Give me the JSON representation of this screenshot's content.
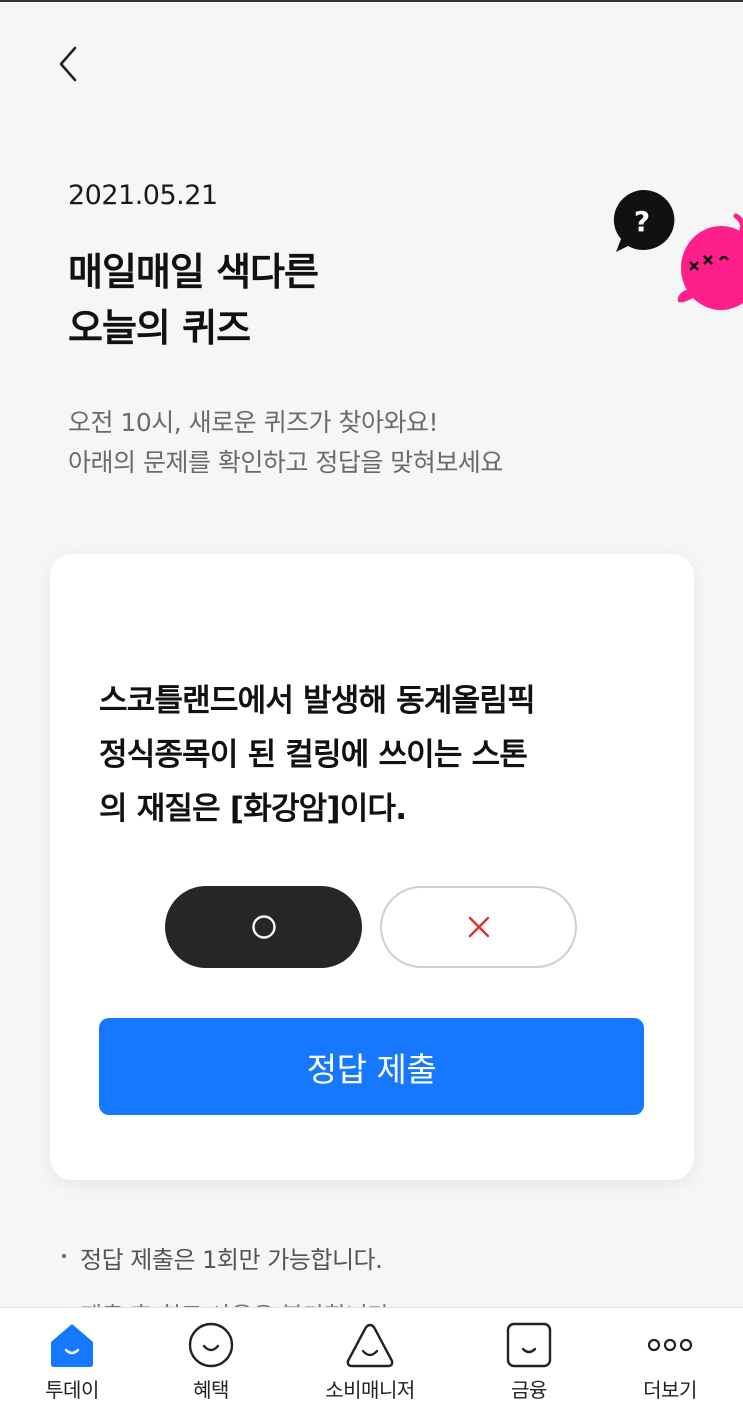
{
  "header": {
    "date": "2021.05.21",
    "title_lines": [
      "매일매일 색다른",
      "오늘의 퀴즈"
    ],
    "subtitle_lines": [
      "오전 10시, 새로운 퀴즈가 찾아와요!",
      "아래의 문제를 확인하고 정답을 맞혀보세요"
    ]
  },
  "quiz": {
    "question_lines": [
      "스코틀랜드에서 발생해 동계올림픽",
      "정식종목이 된 컬링에 쓰이는 스톤",
      "의 재질은 [화강암]이다."
    ],
    "selected_option": "O",
    "submit_label": "정답 제출"
  },
  "notes": [
    "정답 제출은 1회만 가능합니다.",
    "제출 후 힌트 사용은 불가합니다."
  ],
  "tabbar": {
    "items": [
      {
        "label": "투데이",
        "icon": "home-smile-icon",
        "active": true
      },
      {
        "label": "혜택",
        "icon": "smile-circle-icon",
        "active": false
      },
      {
        "label": "소비매니저",
        "icon": "triangle-smile-icon",
        "active": false
      },
      {
        "label": "금융",
        "icon": "square-smile-icon",
        "active": false
      },
      {
        "label": "더보기",
        "icon": "more-dots-icon",
        "active": false
      }
    ]
  },
  "colors": {
    "accent": "#1678ff",
    "selected_option_bg": "#262626",
    "wrong_mark": "#d9342b",
    "mascot_pink": "#ff1f8a"
  }
}
